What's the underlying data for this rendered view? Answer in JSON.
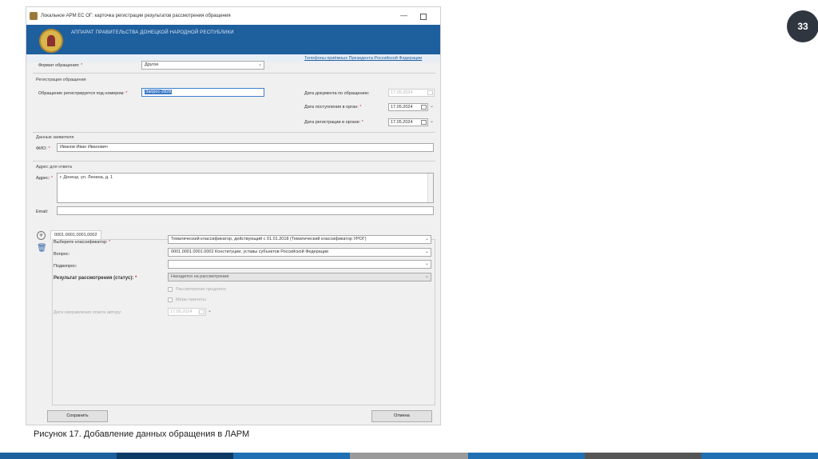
{
  "slide_number": "33",
  "window": {
    "title": "Локальное АРМ ЕС ОГ: карточка регистрации результатов рассмотрения обращения",
    "min_glyph": "—",
    "banner_title": "АППАРАТ ПРАВИТЕЛЬСТВА ДОНЕЦКОЙ НАРОДНОЙ РЕСПУБЛИКИ",
    "banner_link": "Телефоны приёмных Президента Российской Федерации"
  },
  "form": {
    "format_label": "Формат обращения:",
    "format_value": "Другое",
    "registration_section": "Регистрация обращения",
    "reg_number_label": "Обращение регистрируется под номером:",
    "reg_number_value": "Запрос-2828",
    "doc_date_label": "Дата документа по обращению:",
    "doc_date_value": "17.05.2024",
    "received_date_label": "Дата поступления в орган:",
    "received_date_value": "17.05.2024",
    "reg_date_label": "Дата регистрации в органе:",
    "reg_date_value": "17.05.2024",
    "applicant_section": "Данные заявителя",
    "fio_label": "ФИО:",
    "fio_value": "Иванов Иван Иванович",
    "address_section": "Адрес для ответа",
    "address_label": "Адрес:",
    "address_value": "г. Донецк, ул. Ленина, д. 1",
    "email_label": "Email:",
    "email_value": ""
  },
  "classifier": {
    "tab_label": "0001.0001.0001.0002",
    "classifier_label": "Выберите классификатор:",
    "classifier_value": "Тематический классификатор, действующий с 01.01.2018 (Тематический классификатор УРОГ)",
    "question_label": "Вопрос:",
    "question_value": "0001.0001.0001.0002 Конституции, уставы субъектов Российской Федерации",
    "subquestion_label": "Подвопрос:",
    "subquestion_value": "",
    "result_label": "Результат рассмотрения (статус):",
    "result_value": "Находится на рассмотрении",
    "check_extended": "Рассмотрение продлено",
    "check_measures": "Меры приняты",
    "answer_date_label": "Дата направления ответа автору:",
    "answer_date_value": "17.05.2024"
  },
  "buttons": {
    "save": "Сохранить",
    "cancel": "Отмена"
  },
  "caption": "Рисунок 17. Добавление данных обращения в ЛАРМ",
  "colors": {
    "banner": "#1e5f9e",
    "footer": [
      "#1e5f9e",
      "#0d3b66",
      "#1f6fb2",
      "#9a9a9a",
      "#1f6fb2",
      "#555555",
      "#1f6fb2"
    ]
  }
}
